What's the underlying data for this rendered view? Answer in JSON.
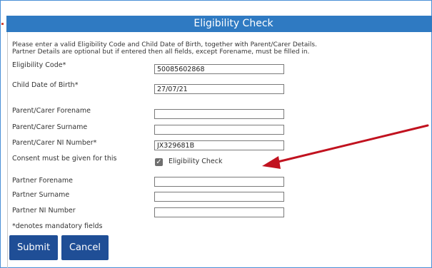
{
  "header": {
    "title": "Eligibility Check"
  },
  "intro": {
    "line1": "Please enter a valid Eligibility Code and Child Date of Birth, together with Parent/Carer Details.",
    "line2": "Partner Details are optional but if entered then all fields, except Forename, must be filled in."
  },
  "fields": {
    "eligibility_code": {
      "label": "Eligibility Code*",
      "value": "50085602868"
    },
    "child_dob": {
      "label": "Child Date of Birth*",
      "value": "27/07/21"
    },
    "parent_forename": {
      "label": "Parent/Carer Forename",
      "value": ""
    },
    "parent_surname": {
      "label": "Parent/Carer Surname",
      "value": ""
    },
    "parent_ni": {
      "label": "Parent/Carer NI Number*",
      "value": "JX329681B"
    },
    "partner_forename": {
      "label": "Partner Forename",
      "value": ""
    },
    "partner_surname": {
      "label": "Partner Surname",
      "value": ""
    },
    "partner_ni": {
      "label": "Partner NI Number",
      "value": ""
    }
  },
  "consent": {
    "label": "Consent must be given for this",
    "checkbox_label": "Eligibility Check",
    "checked": true
  },
  "mandatory_note": "*denotes mandatory fields",
  "buttons": {
    "submit": "Submit",
    "cancel": "Cancel"
  },
  "colors": {
    "header": "#2f7ac2",
    "button": "#1f4e96",
    "arrow": "#c1121f"
  }
}
